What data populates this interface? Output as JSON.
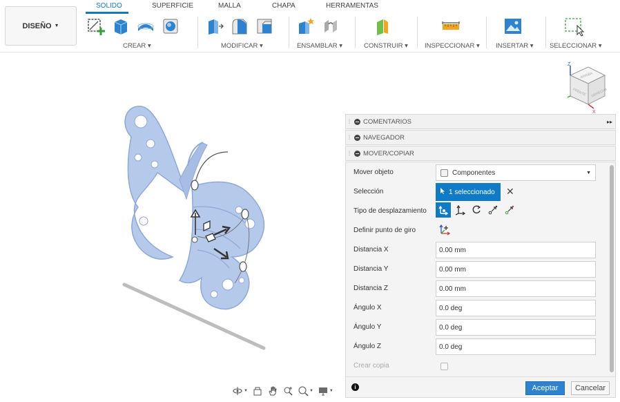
{
  "workspace": {
    "label": "DISEÑO"
  },
  "tabs": [
    {
      "label": "SOLIDO",
      "active": true
    },
    {
      "label": "SUPERFICIE"
    },
    {
      "label": "MALLA"
    },
    {
      "label": "CHAPA"
    },
    {
      "label": "HERRAMENTAS"
    }
  ],
  "groups": {
    "crear": "CREAR",
    "modificar": "MODIFICAR",
    "ensamblar": "ENSAMBLAR",
    "construir": "CONSTRUIR",
    "inspeccionar": "INSPECCIONAR",
    "insertar": "INSERTAR",
    "seleccionar": "SELECCIONAR"
  },
  "panels": {
    "comentarios": "COMENTARIOS",
    "navegador": "NAVEGADOR",
    "mover": "MOVER/COPIAR"
  },
  "dialog": {
    "mover_objeto_label": "Mover objeto",
    "mover_objeto_value": "Componentes",
    "seleccion_label": "Selección",
    "seleccion_value": "1 seleccionado",
    "tipo_label": "Tipo de desplazamiento",
    "pivot_label": "Definir punto de giro",
    "dist_x_label": "Distancia X",
    "dist_x_value": "0.00 mm",
    "dist_y_label": "Distancia Y",
    "dist_y_value": "0.00 mm",
    "dist_z_label": "Distancia Z",
    "dist_z_value": "0.00 mm",
    "ang_x_label": "Ángulo X",
    "ang_x_value": "0.0 deg",
    "ang_y_label": "Ángulo Y",
    "ang_y_value": "0.0 deg",
    "ang_z_label": "Ángulo Z",
    "ang_z_value": "0.0 deg",
    "copy_label": "Crear copia",
    "ok": "Aceptar",
    "cancel": "Cancelar"
  },
  "navcube": {
    "z": "Z",
    "x": "X",
    "top_face": "ARRIBA",
    "front_face": "FRENTE",
    "right_face": "DERECHA"
  },
  "colors": {
    "accent": "#0f7ac8",
    "model": "#b5c9eb",
    "model_edge": "#8ea8d8"
  }
}
